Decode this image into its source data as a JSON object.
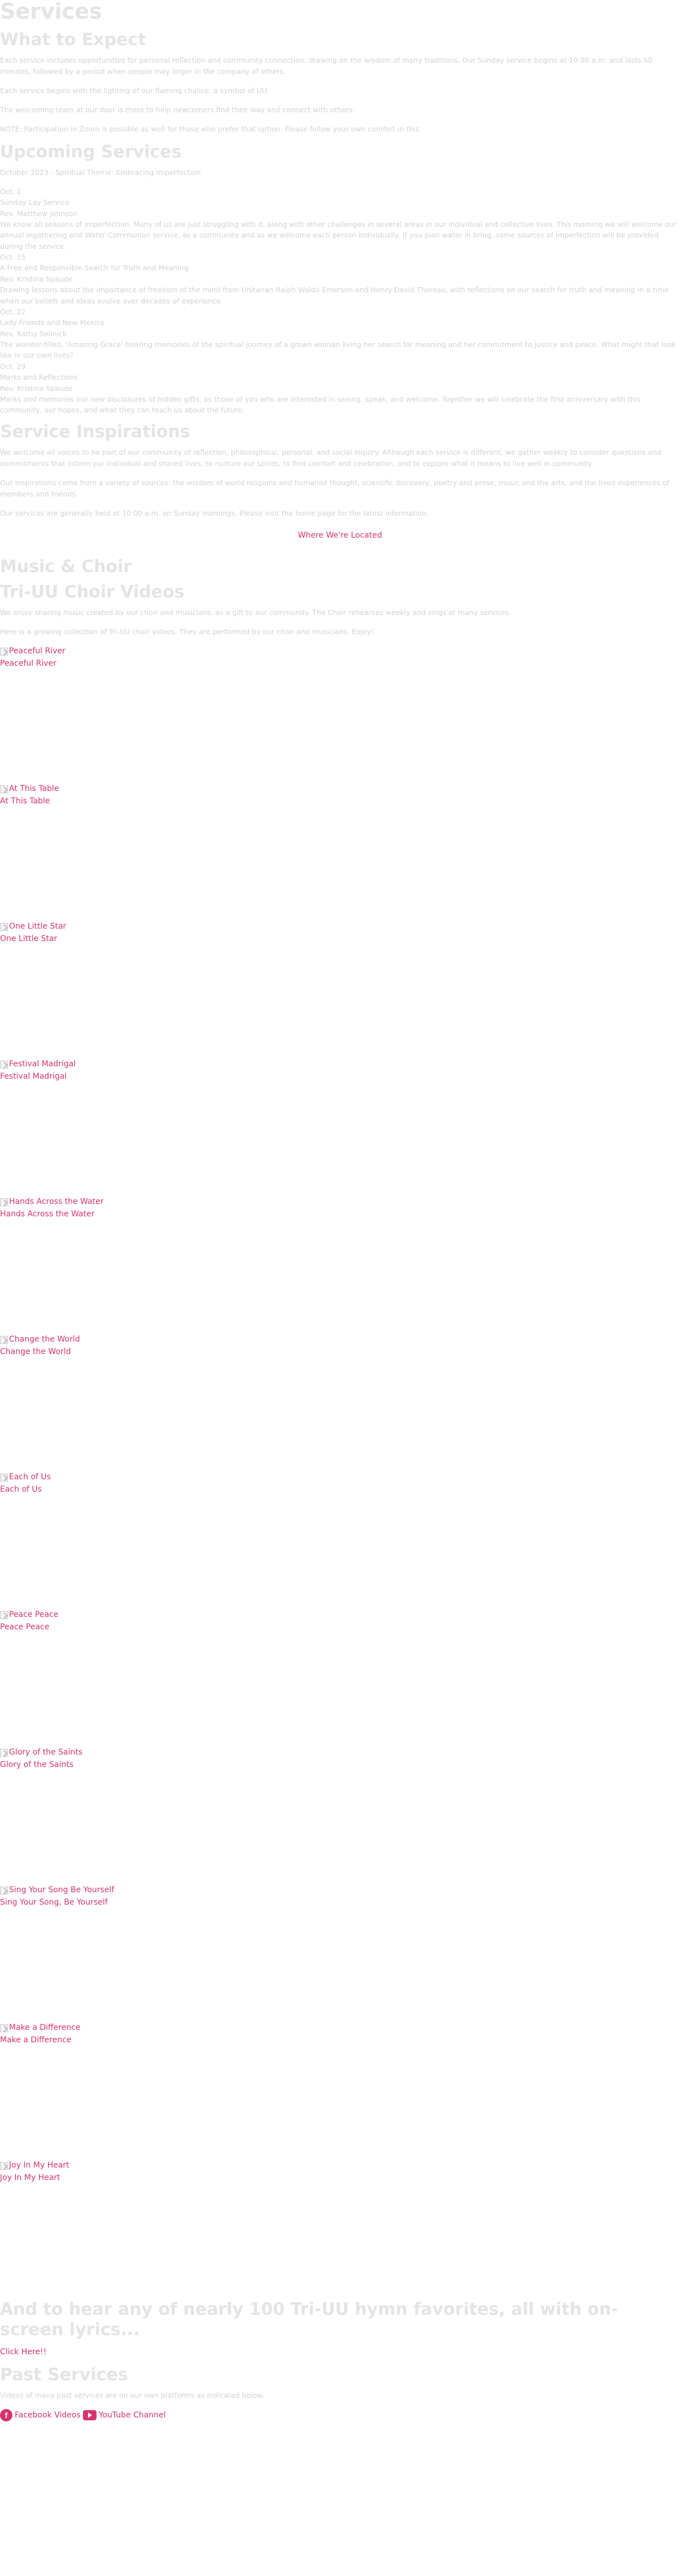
{
  "services": {
    "title": "Services",
    "what_to_expect": {
      "heading": "What to Expect",
      "p1": "Each service includes opportunities for personal reflection and community connection, drawing on the wisdom of many traditions. Our Sunday service begins at 10:00 a.m. and lasts 60 minutes, followed by a period when people may linger in the company of others.",
      "p2": "Each service begins with the lighting of our flaming chalice, a symbol of UU.",
      "p3": "The welcoming team at our door is there to help newcomers find their way and connect with others.",
      "p4": "NOTE: Participation in Zoom is possible as well for those who prefer that option. Please follow your own comfort in this."
    },
    "upcoming": {
      "heading": "Upcoming Services",
      "intro": "October 2023 - Spiritual Theme: Embracing Imperfection",
      "events": [
        "Oct. 1",
        "Sunday Lay Service",
        "Rev. Matthew Johnson",
        "We know all seasons of imperfection. Many of us are just struggling with it, along with other challenges in several areas in our individual and collective lives. This morning we will welcome our annual ingathering and Water Communion service, as a community and as we welcome each person individually. If you plan water in bring, some sources of imperfection will be provided during the service.",
        "Oct. 15",
        "A Free and Responsible Search for Truth and Meaning",
        "Rev. Kristina Spaude",
        "Drawing lessons about the importance of freedom of the mind from Unitarian Ralph Waldo Emerson and Henry David Thoreau, with reflections on our search for truth and meaning in a time when our beliefs and ideas evolve over decades of experience.",
        "Oct. 22",
        "Lady Friends and New Mexico",
        "Rev. Kathy Sellnick",
        "The wonder-filled, 'Amazing Grace'-bearing memories of the spiritual journey of a grown woman living her search for meaning and her commitment to justice and peace. What might that look like in our own lives?",
        "Oct. 29",
        "Marks and Reflections",
        "Rev. Kristina Spaude",
        "Marks and memories our new disclosures of hidden gifts, as those of you who are interested in seeing, speak, and welcome. Together we will celebrate the first anniversary with this community, our hopes, and what they can teach us about the future."
      ]
    },
    "inspirations": {
      "heading": "Service Inspirations",
      "p1": "We welcome all voices to be part of our community of reflection, philosophical, personal, and social inquiry. Although each service is different, we gather weekly to consider questions and commitments that inform our individual and shared lives, to nurture our spirits, to find comfort and celebration, and to explore what it means to live well in community.",
      "p2": "Our inspirations come from a variety of sources: the wisdom of world religions and humanist thought, scientific discovery, poetry and prose, music and the arts, and the lived experiences of members and friends.",
      "p3": "Our services are generally held at 10:00 a.m. on Sunday mornings. Please visit the home page for the latest information.",
      "location_link": "Where We're Located"
    }
  },
  "music": {
    "heading": "Music & Choir",
    "choir_heading": "Tri-UU Choir Videos",
    "p1": "We enjoy sharing music created by our choir and musicians, as a gift to our community. The Choir rehearses weekly and sings at many services.",
    "p2": "Here is a growing collection of Tri-UU choir videos. They are performed by our choir and musicians. Enjoy!",
    "videos": [
      {
        "alt": "Peaceful River",
        "caption": "Peaceful River"
      },
      {
        "alt": "At This Table",
        "caption": "At This Table"
      },
      {
        "alt": "One Little Star",
        "caption": "One Little Star"
      },
      {
        "alt": "Festival Madrigal",
        "caption": "Festival Madrigal"
      },
      {
        "alt": "Hands Across the Water",
        "caption": "Hands Across the Water"
      },
      {
        "alt": "Change the World",
        "caption": "Change the World"
      },
      {
        "alt": "Each of Us",
        "caption": "Each of Us"
      },
      {
        "alt": "Peace Peace",
        "caption": "Peace Peace"
      },
      {
        "alt": "Glory of the Saints",
        "caption": "Glory of the Saints"
      },
      {
        "alt": "Sing Your Song Be Yourself",
        "caption": "Sing Your Song, Be Yourself"
      },
      {
        "alt": "Make a Difference",
        "caption": "Make a Difference"
      },
      {
        "alt": "Joy In My Heart",
        "caption": "Joy In My Heart"
      }
    ],
    "hymns_heading": "And to hear any of nearly 100 Tri-UU hymn favorites, all with on-screen lyrics...",
    "hymns_link": "Click Here!!"
  },
  "past": {
    "heading": "Past Services",
    "text": "Videos of many past services are on our own platforms as indicated below.",
    "facebook_label": "Facebook Videos",
    "youtube_label": "YouTube Channel",
    "facebook_icon": "facebook-icon",
    "youtube_icon": "youtube-icon"
  },
  "colors": {
    "accent": "#d6336c",
    "faded_text": "#d6d6d6"
  }
}
